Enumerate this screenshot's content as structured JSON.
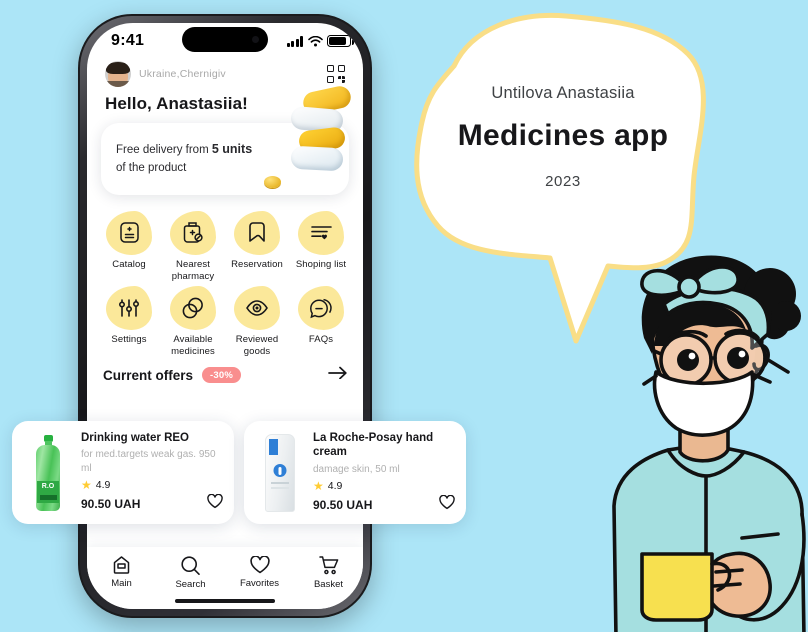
{
  "background_color": "#ace5f7",
  "accent_yellow": "#fbe89a",
  "badge_color": "#f98e8e",
  "poster": {
    "author": "Untilova Anastasiia",
    "title": "Medicines app",
    "year": "2023"
  },
  "phone": {
    "statusbar": {
      "time": "9:41",
      "cellular_icon": "signal-bars-icon",
      "wifi_icon": "wifi-icon",
      "battery_icon": "battery-icon"
    },
    "header": {
      "avatar": "user-avatar",
      "location": "Ukraine,Chernigiv",
      "qr_icon": "qr-code-icon"
    },
    "greeting": "Hello, Anastasiia!",
    "promo": {
      "text_before": "Free delivery from ",
      "highlight": "5 units",
      "text_after": "of the product",
      "art": "pill-stack-illustration",
      "coin": "coin-illustration"
    },
    "menu": [
      {
        "label": "Catalog",
        "icon": "catalog-icon"
      },
      {
        "label": "Nearest pharmacy",
        "icon": "pharmacy-bottle-icon"
      },
      {
        "label": "Reservation",
        "icon": "bookmark-icon"
      },
      {
        "label": "Shoping list",
        "icon": "list-heart-icon"
      },
      {
        "label": "Settings",
        "icon": "sliders-icon"
      },
      {
        "label": "Available medicines",
        "icon": "pills-circles-icon"
      },
      {
        "label": "Reviewed goods",
        "icon": "eye-icon"
      },
      {
        "label": "FAQs",
        "icon": "chat-bubble-icon"
      }
    ],
    "offers": {
      "title": "Current offers",
      "discount": "-30%",
      "arrow_icon": "arrow-right-icon",
      "products": [
        {
          "name": "Drinking water REO",
          "desc": "for med.targets weak gas. 950 ml",
          "rating": "4.9",
          "price": "90.50 UAH",
          "thumb": "water-bottle-image",
          "favorite_icon": "heart-outline-icon"
        },
        {
          "name": "La Roche-Posay hand cream",
          "desc": "damage skin, 50 ml",
          "rating": "4.9",
          "price": "90.50 UAH",
          "thumb": "cream-tube-image",
          "favorite_icon": "heart-outline-icon"
        }
      ]
    },
    "tabbar": [
      {
        "label": "Main",
        "icon": "home-icon"
      },
      {
        "label": "Search",
        "icon": "search-icon"
      },
      {
        "label": "Favorites",
        "icon": "heart-icon"
      },
      {
        "label": "Basket",
        "icon": "cart-icon"
      }
    ]
  },
  "illustration": {
    "alt": "woman-with-mask-and-mug-illustration"
  }
}
